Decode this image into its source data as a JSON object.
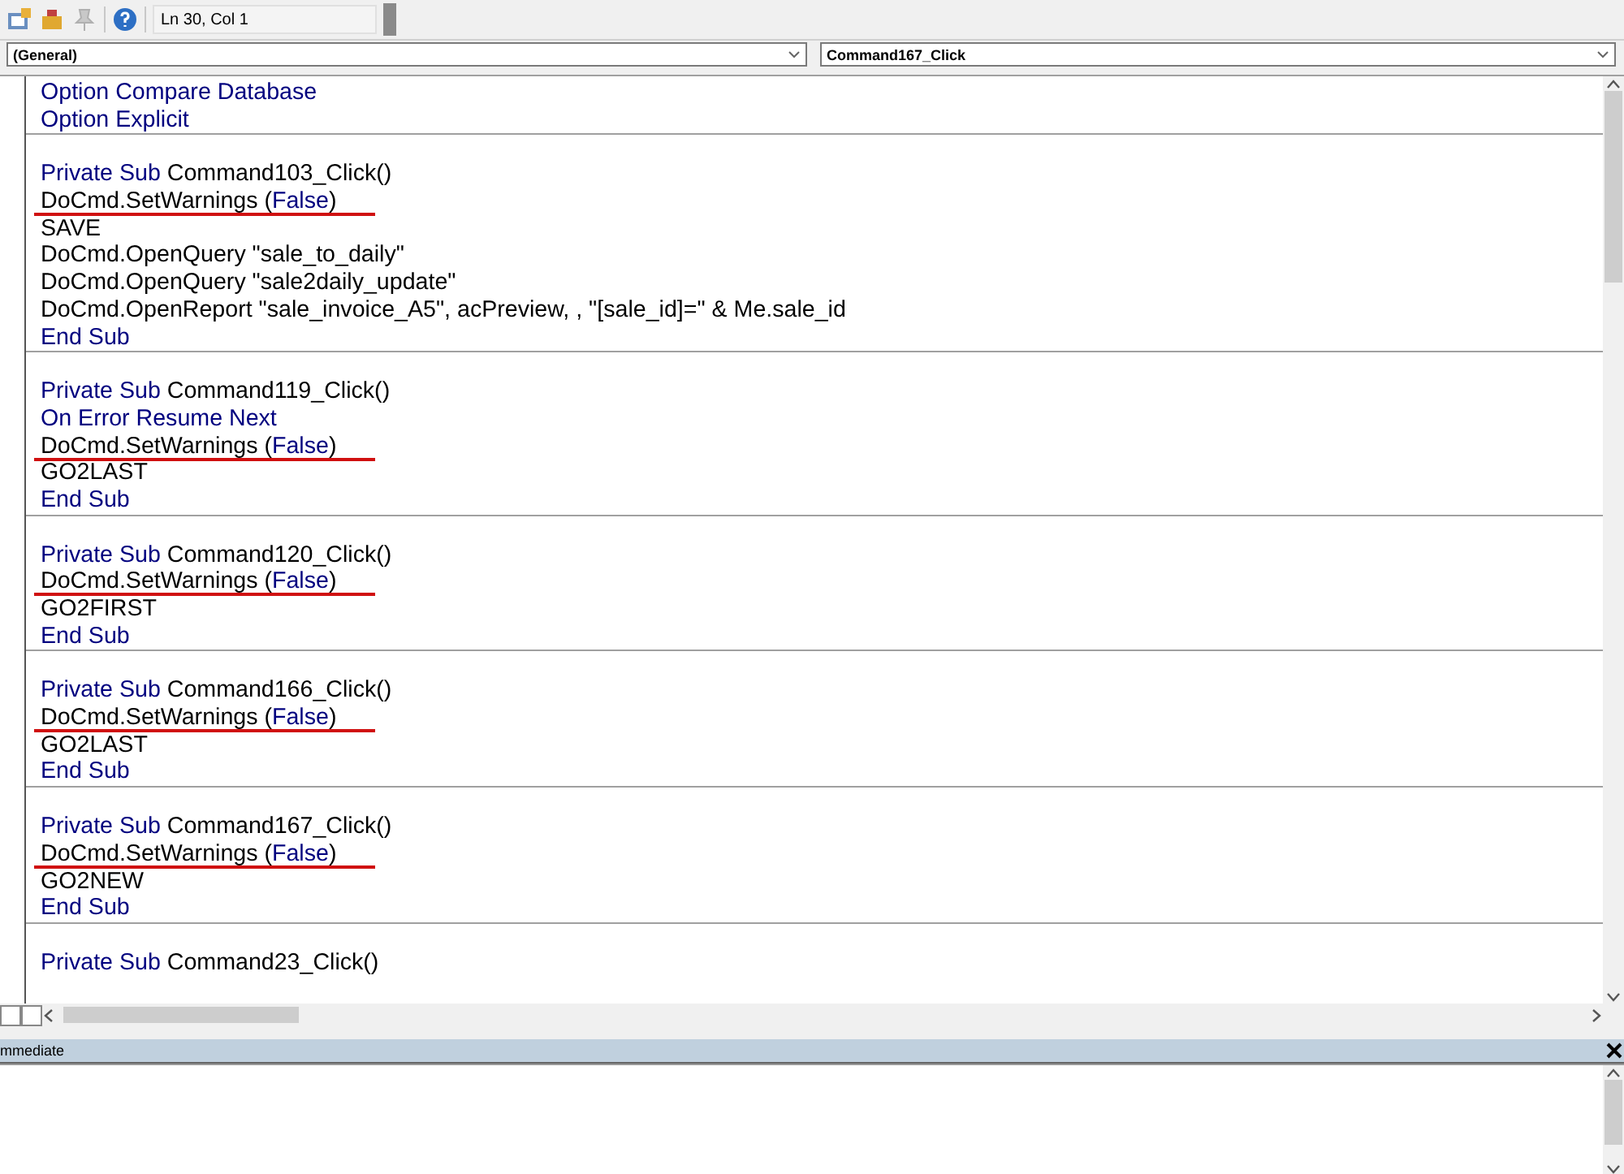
{
  "toolbar": {
    "position": "Ln 30, Col 1"
  },
  "object_dropdown": {
    "value": "(General)"
  },
  "procedure_dropdown": {
    "value": "Command167_Click"
  },
  "code_sections": [
    {
      "lines": [
        {
          "underlined": false,
          "segments": [
            {
              "text": "Option Compare Database",
              "kind": "keyword"
            }
          ]
        },
        {
          "underlined": false,
          "segments": [
            {
              "text": "Option Explicit",
              "kind": "keyword"
            }
          ]
        }
      ]
    },
    {
      "lines": [
        {
          "underlined": false,
          "segments": [
            {
              "text": "Private Sub",
              "kind": "keyword"
            },
            {
              "text": " Command103_Click()",
              "kind": "plain"
            }
          ]
        },
        {
          "underlined": true,
          "segments": [
            {
              "text": "DoCmd.SetWarnings (",
              "kind": "plain"
            },
            {
              "text": "False",
              "kind": "keyword"
            },
            {
              "text": ")",
              "kind": "plain"
            }
          ]
        },
        {
          "underlined": false,
          "segments": [
            {
              "text": "SAVE",
              "kind": "plain"
            }
          ]
        },
        {
          "underlined": false,
          "segments": [
            {
              "text": "DoCmd.OpenQuery \"sale_to_daily\"",
              "kind": "plain"
            }
          ]
        },
        {
          "underlined": false,
          "segments": [
            {
              "text": "DoCmd.OpenQuery \"sale2daily_update\"",
              "kind": "plain"
            }
          ]
        },
        {
          "underlined": false,
          "segments": [
            {
              "text": "DoCmd.OpenReport \"sale_invoice_A5\", acPreview, , \"[sale_id]=\" & Me.sale_id",
              "kind": "plain"
            }
          ]
        },
        {
          "underlined": false,
          "segments": [
            {
              "text": "End Sub",
              "kind": "keyword"
            }
          ]
        }
      ]
    },
    {
      "lines": [
        {
          "underlined": false,
          "segments": [
            {
              "text": "Private Sub",
              "kind": "keyword"
            },
            {
              "text": " Command119_Click()",
              "kind": "plain"
            }
          ]
        },
        {
          "underlined": false,
          "segments": [
            {
              "text": "On Error Resume Next",
              "kind": "keyword"
            }
          ]
        },
        {
          "underlined": true,
          "segments": [
            {
              "text": "DoCmd.SetWarnings (",
              "kind": "plain"
            },
            {
              "text": "False",
              "kind": "keyword"
            },
            {
              "text": ")",
              "kind": "plain"
            }
          ]
        },
        {
          "underlined": false,
          "segments": [
            {
              "text": "GO2LAST",
              "kind": "plain"
            }
          ]
        },
        {
          "underlined": false,
          "segments": [
            {
              "text": "End Sub",
              "kind": "keyword"
            }
          ]
        }
      ]
    },
    {
      "lines": [
        {
          "underlined": false,
          "segments": [
            {
              "text": "Private Sub",
              "kind": "keyword"
            },
            {
              "text": " Command120_Click()",
              "kind": "plain"
            }
          ]
        },
        {
          "underlined": true,
          "segments": [
            {
              "text": "DoCmd.SetWarnings (",
              "kind": "plain"
            },
            {
              "text": "False",
              "kind": "keyword"
            },
            {
              "text": ")",
              "kind": "plain"
            }
          ]
        },
        {
          "underlined": false,
          "segments": [
            {
              "text": "GO2FIRST",
              "kind": "plain"
            }
          ]
        },
        {
          "underlined": false,
          "segments": [
            {
              "text": "End Sub",
              "kind": "keyword"
            }
          ]
        }
      ]
    },
    {
      "lines": [
        {
          "underlined": false,
          "segments": [
            {
              "text": "Private Sub",
              "kind": "keyword"
            },
            {
              "text": " Command166_Click()",
              "kind": "plain"
            }
          ]
        },
        {
          "underlined": true,
          "segments": [
            {
              "text": "DoCmd.SetWarnings (",
              "kind": "plain"
            },
            {
              "text": "False",
              "kind": "keyword"
            },
            {
              "text": ")",
              "kind": "plain"
            }
          ]
        },
        {
          "underlined": false,
          "segments": [
            {
              "text": "GO2LAST",
              "kind": "plain"
            }
          ]
        },
        {
          "underlined": false,
          "segments": [
            {
              "text": "End Sub",
              "kind": "keyword"
            }
          ]
        }
      ]
    },
    {
      "lines": [
        {
          "underlined": false,
          "segments": [
            {
              "text": "Private Sub",
              "kind": "keyword"
            },
            {
              "text": " Command167_Click()",
              "kind": "plain"
            }
          ]
        },
        {
          "underlined": true,
          "segments": [
            {
              "text": "DoCmd.SetWarnings (",
              "kind": "plain"
            },
            {
              "text": "False",
              "kind": "keyword"
            },
            {
              "text": ")",
              "kind": "plain"
            }
          ]
        },
        {
          "underlined": false,
          "segments": [
            {
              "text": "GO2NEW",
              "kind": "plain"
            }
          ]
        },
        {
          "underlined": false,
          "segments": [
            {
              "text": "End Sub",
              "kind": "keyword"
            }
          ]
        }
      ]
    },
    {
      "lines": [
        {
          "underlined": false,
          "segments": [
            {
              "text": "Private Sub",
              "kind": "keyword"
            },
            {
              "text": " Command23_Click()",
              "kind": "plain"
            }
          ]
        }
      ]
    }
  ],
  "immediate_pane": {
    "title": "mmediate"
  }
}
